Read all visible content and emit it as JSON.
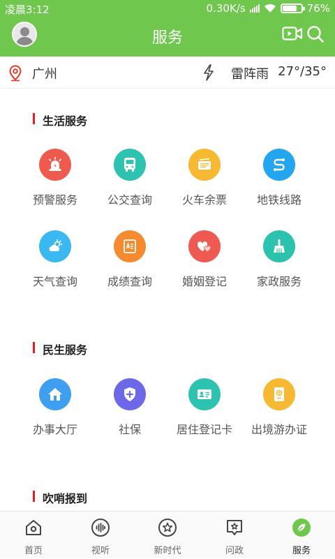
{
  "status": {
    "time": "凌晨3:12",
    "speed": "0.30K/s",
    "battery": "76%",
    "battery_level": 0.76
  },
  "header": {
    "title": "服务"
  },
  "weather": {
    "city": "广州",
    "condition": "雷阵雨",
    "temperature": "27°/35°"
  },
  "sections": [
    {
      "title": "生活服务",
      "items": [
        {
          "label": "预警服务",
          "icon": "alarm-light-icon",
          "color": "#ef5a4e"
        },
        {
          "label": "公交查询",
          "icon": "bus-icon",
          "color": "#2ec3b0"
        },
        {
          "label": "火车余票",
          "icon": "ticket-icon",
          "color": "#f8b932"
        },
        {
          "label": "地铁线路",
          "icon": "subway-route-icon",
          "color": "#23a5ef"
        },
        {
          "label": "天气查询",
          "icon": "weather-icon",
          "color": "#3bb8ef"
        },
        {
          "label": "成绩查询",
          "icon": "score-card-icon",
          "color": "#f58b2e"
        },
        {
          "label": "婚姻登记",
          "icon": "hearts-icon",
          "color": "#ee5a52"
        },
        {
          "label": "家政服务",
          "icon": "broom-icon",
          "color": "#2cc3ae"
        }
      ]
    },
    {
      "title": "民生服务",
      "items": [
        {
          "label": "办事大厅",
          "icon": "home-icon",
          "color": "#3e9ef0"
        },
        {
          "label": "社保",
          "icon": "shield-icon",
          "color": "#6c68e8"
        },
        {
          "label": "居住登记卡",
          "icon": "id-card-icon",
          "color": "#2ec3b0"
        },
        {
          "label": "出境游办证",
          "icon": "passport-icon",
          "color": "#f8b932"
        }
      ]
    },
    {
      "title": "吹哨报到",
      "items": []
    }
  ],
  "tabs": [
    {
      "label": "首页",
      "icon": "home-tab-icon"
    },
    {
      "label": "视听",
      "icon": "audio-tab-icon"
    },
    {
      "label": "新时代",
      "icon": "star-tab-icon"
    },
    {
      "label": "问政",
      "icon": "inquiry-tab-icon"
    },
    {
      "label": "服务",
      "icon": "service-tab-icon",
      "active": true
    }
  ],
  "colors": {
    "brand": "#6fc74e",
    "accent_bar": "#e02020",
    "active_tab": "#6fc74e"
  }
}
